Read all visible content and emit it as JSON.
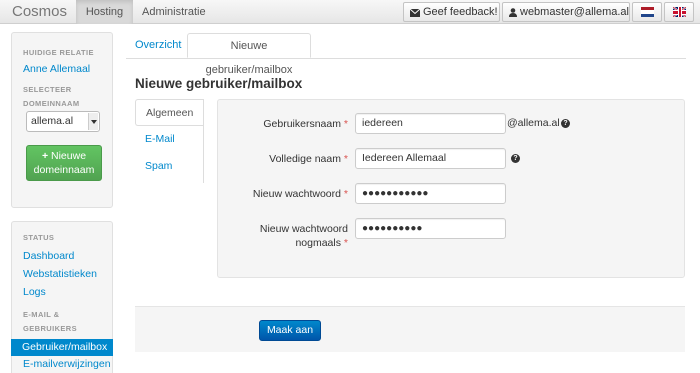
{
  "navbar": {
    "brand": "Cosmos",
    "links": [
      "Hosting",
      "Administratie"
    ],
    "feedback_label": "Geef feedback!",
    "user_label": "webmaster@allema.al",
    "flags": [
      "nl",
      "gb"
    ]
  },
  "sidebar": {
    "relation_label": "HUIDIGE RELATIE",
    "relation_name": "Anne Allemaal",
    "domain_label_1": "SELECTEER",
    "domain_label_2": "DOMEINNAAM",
    "domain_selected": "allema.al",
    "new_domain_button_1": "Nieuwe",
    "new_domain_button_2": "domeinnaam",
    "status_label": "STATUS",
    "status_links": [
      "Dashboard",
      "Webstatistieken",
      "Logs"
    ],
    "email_label_1": "E-MAIL &",
    "email_label_2": "GEBRUIKERS",
    "email_links": [
      "Gebruiker/mailbox",
      "E-mailverwijzingen"
    ]
  },
  "tabs": [
    "Overzicht",
    "Nieuwe gebruiker/mailbox"
  ],
  "page_title": "Nieuwe gebruiker/mailbox",
  "vertical_tabs": [
    "Algemeen",
    "E-Mail",
    "Spam"
  ],
  "form": {
    "username_label": "Gebruikersnaam",
    "username_value": "iedereen",
    "domain_suffix": "@allema.al",
    "fullname_label": "Volledige naam",
    "fullname_value": "Iedereen Allemaal",
    "password_label": "Nieuw wachtwoord",
    "password_value": "●●●●●●●●●●●",
    "password_repeat_label_1": "Nieuw wachtwoord",
    "password_repeat_label_2": "nogmaals",
    "password_repeat_value": "●●●●●●●●●●",
    "required_marker": "*",
    "help_glyph": "?"
  },
  "submit_label": "Maak aan",
  "colors": {
    "link": "#0088cc",
    "active": "#0088cc",
    "success": "#51a351",
    "required": "#d9534f"
  }
}
